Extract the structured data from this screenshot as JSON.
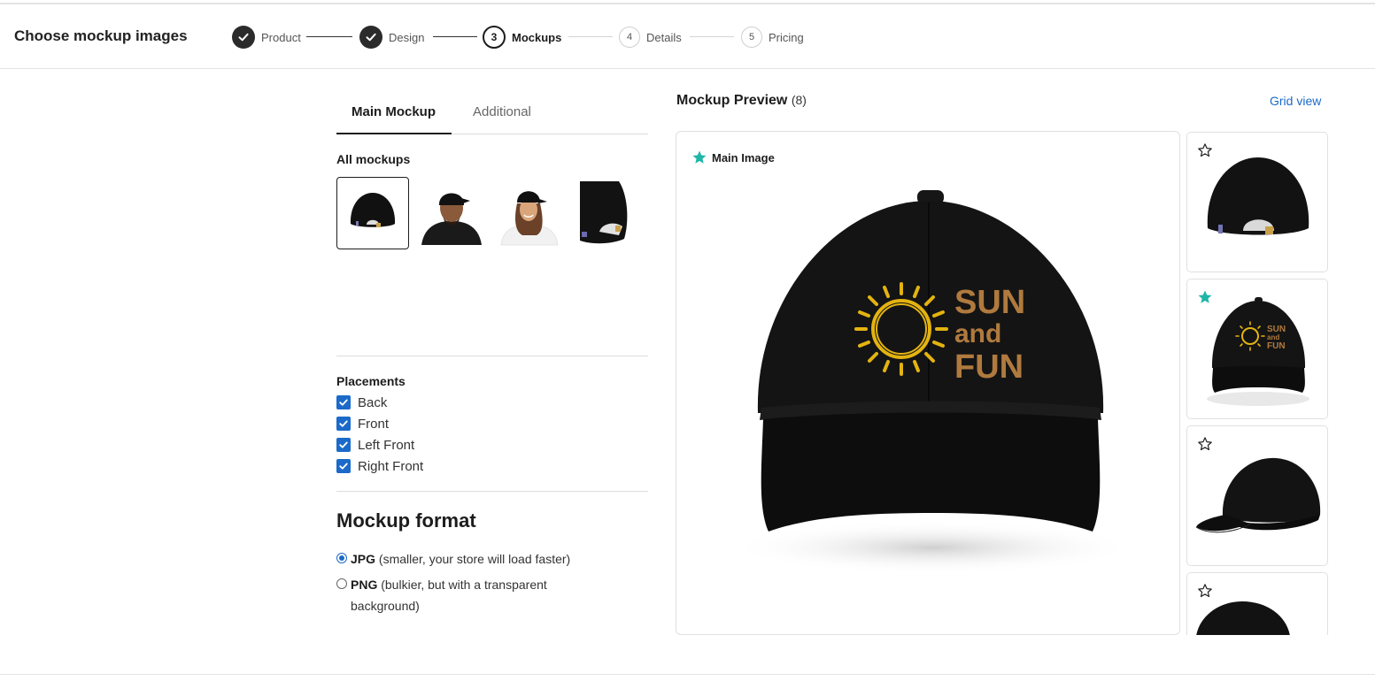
{
  "header": {
    "title": "Choose mockup images"
  },
  "steps": [
    {
      "number": "",
      "label": "Product",
      "state": "done"
    },
    {
      "number": "",
      "label": "Design",
      "state": "done"
    },
    {
      "number": "3",
      "label": "Mockups",
      "state": "current"
    },
    {
      "number": "4",
      "label": "Details",
      "state": "todo"
    },
    {
      "number": "5",
      "label": "Pricing",
      "state": "todo"
    }
  ],
  "tabs": {
    "main": "Main Mockup",
    "additional": "Additional"
  },
  "all_mockups": {
    "label": "All mockups",
    "thumbnails": [
      "hat-back",
      "man-wearing-hat-back",
      "woman-wearing-hat",
      "hat-back-closeup"
    ]
  },
  "placements": {
    "label": "Placements",
    "items": [
      {
        "label": "Back",
        "checked": true
      },
      {
        "label": "Front",
        "checked": true
      },
      {
        "label": "Left Front",
        "checked": true
      },
      {
        "label": "Right Front",
        "checked": true
      }
    ]
  },
  "mockup_format": {
    "title": "Mockup format",
    "options": [
      {
        "name": "JPG",
        "desc": " (smaller, your store will load faster)",
        "selected": true
      },
      {
        "name": "PNG",
        "desc": " (bulkier, but with a transparent background)",
        "selected": false
      }
    ]
  },
  "preview": {
    "title": "Mockup Preview",
    "count": "(8)",
    "grid_view": "Grid view",
    "main_badge": "Main Image",
    "design_text": {
      "line1": "SUN",
      "line2": "and",
      "line3": "FUN"
    },
    "side_cards": [
      {
        "view": "back",
        "is_main": false
      },
      {
        "view": "front",
        "is_main": true
      },
      {
        "view": "left",
        "is_main": false
      },
      {
        "view": "back-partial",
        "is_main": false
      }
    ]
  },
  "colors": {
    "accent": "#1b6ac9",
    "star_main": "#1fb5a8",
    "hat": "#111111",
    "embroidery_gold": "#e3b310",
    "embroidery_tan": "#b07a3e"
  }
}
